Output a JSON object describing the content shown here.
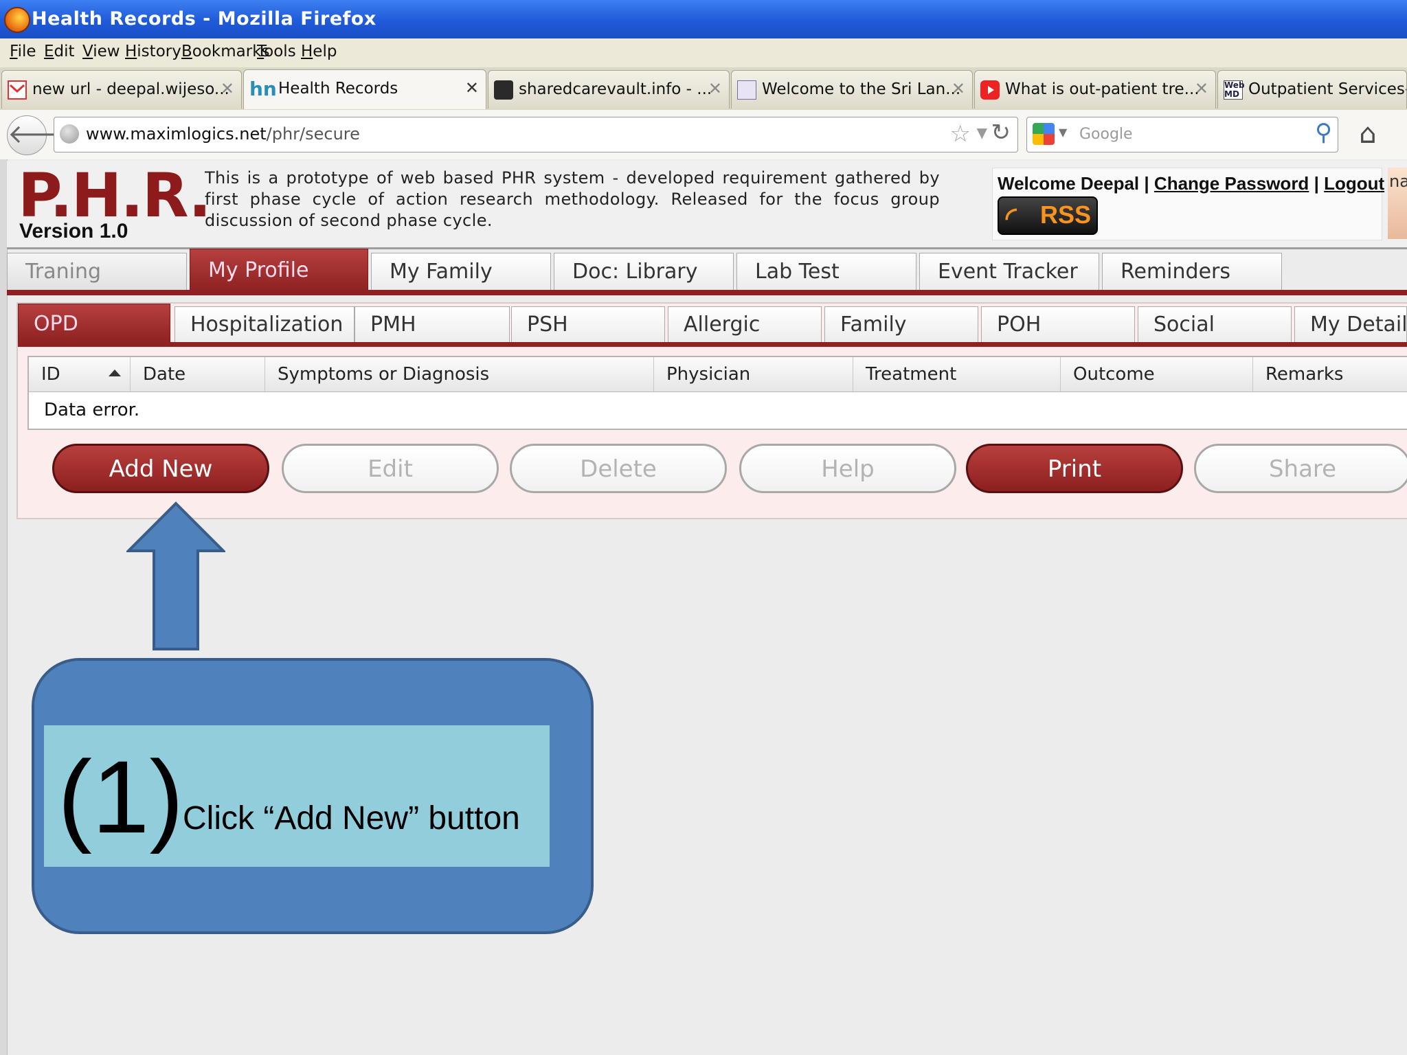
{
  "window": {
    "title": "Health Records - Mozilla Firefox"
  },
  "menu": [
    "File",
    "Edit",
    "View",
    "History",
    "Bookmarks",
    "Tools",
    "Help"
  ],
  "tabs": [
    {
      "label": "new url - deepal.wijeso...",
      "icon": "gmail-icon"
    },
    {
      "label": "Health Records",
      "icon": "hn-icon",
      "active": true
    },
    {
      "label": "sharedcarevault.info - ...",
      "icon": "site-icon"
    },
    {
      "label": "Welcome to the Sri Lan...",
      "icon": "site-icon"
    },
    {
      "label": "What is out-patient tre...",
      "icon": "youtube-icon"
    },
    {
      "label": "Outpatient Services-Ir",
      "icon": "webmd-icon"
    }
  ],
  "nav": {
    "url_host": "www.maximlogics.net",
    "url_path": "/phr/secure",
    "search_placeholder": "Google"
  },
  "header": {
    "logo": "P.H.R.",
    "version": "Version 1.0",
    "intro": "This is a prototype of web based PHR system - developed requirement gathered by first phase cycle of action research methodology. Released for the focus group discussion of second phase cycle.",
    "welcome": "Welcome Deepal",
    "sep": "|",
    "change_password": "Change Password",
    "logout": "Logout",
    "rss": "RSS",
    "side_text": "na"
  },
  "main_tabs": [
    "Traning",
    "My Profile",
    "My Family",
    "Doc: Library",
    "Lab Test",
    "Event Tracker",
    "Reminders"
  ],
  "main_tab_active": "My Profile",
  "sub_tabs": [
    "OPD",
    "Hospitalization",
    "PMH",
    "PSH",
    "Allergic",
    "Family",
    "POH",
    "Social",
    "My Details"
  ],
  "sub_tab_active": "OPD",
  "grid": {
    "columns": [
      "ID",
      "Date",
      "Symptoms or Diagnosis",
      "Physician",
      "Treatment",
      "Outcome",
      "Remarks"
    ],
    "message": "Data error."
  },
  "buttons": {
    "add_new": "Add New",
    "edit": "Edit",
    "delete": "Delete",
    "help": "Help",
    "print": "Print",
    "share": "Share"
  },
  "callout": {
    "number": "(1)",
    "text": "Click  “Add New” button"
  },
  "colors": {
    "brand": "#8e1b1b",
    "accent_tab": "#8e2121",
    "callout_fill": "#4f81bd",
    "callout_inner": "#92cddc"
  }
}
